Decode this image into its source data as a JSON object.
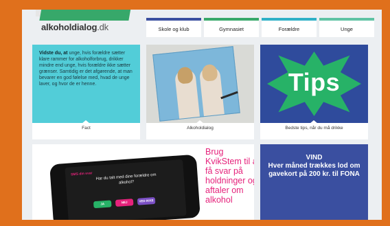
{
  "header": {
    "brand": "alkoholdialog",
    "brand_tld": ".dk",
    "nav": [
      "Skole og klub",
      "Gymnasiet",
      "Forældre",
      "Unge"
    ]
  },
  "cards": [
    {
      "lead": "Vidste du, at",
      "text": "unge, hvis forældre sætter klare rammer for alkoholforbrug, drikker mindre end unge, hvis forældre ikke sætter grænser. Samtidig er det afgørende, at man bevarer en god følelse med, hvad de unge laver, og hvor de er henne.",
      "caption": "Fact"
    },
    {
      "caption": "Alkoholdialog"
    },
    {
      "image_word": "Tips",
      "caption": "Bedste tips, når du må drikke"
    }
  ],
  "phone": {
    "app_name": "SMS din svar",
    "question": "Har du talt med dine forældre om alkohol?",
    "buttons": [
      "JA",
      "NEJ",
      "VED IKKE"
    ]
  },
  "promo": "Brug KvikStem til at få svar på holdninger og aftaler om alkohol",
  "contest": {
    "headline": "VIND",
    "text": "Hver måned trækkes lod om gavekort på 200 kr. til FONA"
  },
  "colors": {
    "frame": "#e0701c",
    "fact": "#52cdd8",
    "tips_bg": "#2f4b9c",
    "tips_star": "#27b267",
    "promo": "#e5227b",
    "contest_bg": "#3a4fa0"
  }
}
